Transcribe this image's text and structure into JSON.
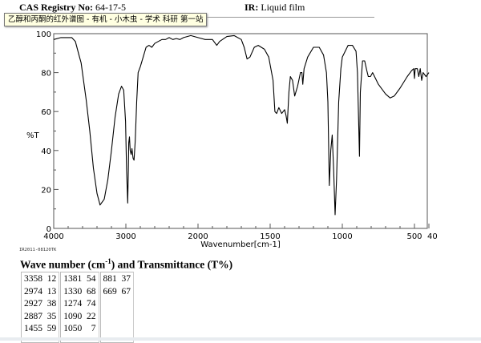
{
  "header": {
    "cas_label": "CAS Registry No:",
    "cas_value": "64-17-5",
    "ir_label": "IR:",
    "ir_value": "Liquid film"
  },
  "tooltip": "乙醇和丙酮的红外谱图 - 有机 - 小木虫 - 学术 科研 第一站",
  "spectrum_code": "IR2011-08120TK",
  "table": {
    "title_pre": "Wave number (cm",
    "title_sup": "-1",
    "title_post": ") and Transmittance (T%)",
    "columns": [
      [
        "3358  12",
        "2974  13",
        "2927  38",
        "2887  35",
        "1455  59"
      ],
      [
        "1381  54",
        "1330  68",
        "1274  74",
        "1090  22",
        "1050    7"
      ],
      [
        "881  37",
        "669  67"
      ]
    ]
  },
  "chart_data": {
    "type": "line",
    "xlabel": "Wavenumber[cm-1]",
    "ylabel": "%T",
    "xlim": [
      4000,
      400
    ],
    "ylim": [
      0,
      100
    ],
    "x_scale": "piecewise linear: 4000-2000 at half the density of 2000-400",
    "x_ticks": [
      4000,
      3000,
      2000,
      1500,
      1000,
      500,
      400
    ],
    "x_tick_labels": [
      "4000",
      "3000",
      "2000",
      "1500",
      "1000",
      "500",
      "40"
    ],
    "y_ticks": [
      0,
      20,
      40,
      60,
      80,
      100
    ],
    "grid": false,
    "line_color": "#000000",
    "peaks": [
      [
        3358,
        12
      ],
      [
        2974,
        13
      ],
      [
        2927,
        38
      ],
      [
        2887,
        35
      ],
      [
        1455,
        59
      ],
      [
        1381,
        54
      ],
      [
        1330,
        68
      ],
      [
        1274,
        74
      ],
      [
        1090,
        22
      ],
      [
        1050,
        7
      ],
      [
        881,
        37
      ],
      [
        669,
        67
      ]
    ],
    "series": [
      {
        "points": [
          [
            4000,
            97
          ],
          [
            3900,
            98
          ],
          [
            3750,
            98
          ],
          [
            3700,
            96
          ],
          [
            3650,
            89
          ],
          [
            3620,
            85
          ],
          [
            3550,
            66
          ],
          [
            3500,
            50
          ],
          [
            3450,
            31
          ],
          [
            3400,
            18
          ],
          [
            3358,
            12
          ],
          [
            3300,
            15
          ],
          [
            3250,
            25
          ],
          [
            3200,
            40
          ],
          [
            3150,
            57
          ],
          [
            3100,
            69
          ],
          [
            3060,
            73
          ],
          [
            3030,
            71
          ],
          [
            3005,
            55
          ],
          [
            2990,
            30
          ],
          [
            2974,
            13
          ],
          [
            2966,
            30
          ],
          [
            2960,
            44
          ],
          [
            2950,
            47
          ],
          [
            2940,
            40
          ],
          [
            2927,
            38
          ],
          [
            2915,
            41
          ],
          [
            2900,
            36
          ],
          [
            2887,
            35
          ],
          [
            2870,
            45
          ],
          [
            2850,
            65
          ],
          [
            2830,
            80
          ],
          [
            2800,
            83
          ],
          [
            2760,
            88
          ],
          [
            2720,
            93
          ],
          [
            2680,
            94
          ],
          [
            2640,
            93
          ],
          [
            2600,
            95
          ],
          [
            2550,
            96
          ],
          [
            2500,
            97
          ],
          [
            2450,
            97
          ],
          [
            2400,
            98
          ],
          [
            2350,
            97
          ],
          [
            2300,
            97.5
          ],
          [
            2250,
            97
          ],
          [
            2200,
            98
          ],
          [
            2100,
            99
          ],
          [
            2050,
            98.5
          ],
          [
            2000,
            98
          ],
          [
            1950,
            97
          ],
          [
            1900,
            97
          ],
          [
            1870,
            94
          ],
          [
            1850,
            96
          ],
          [
            1800,
            98.5
          ],
          [
            1750,
            99
          ],
          [
            1700,
            97
          ],
          [
            1680,
            93
          ],
          [
            1660,
            87
          ],
          [
            1640,
            88
          ],
          [
            1610,
            93
          ],
          [
            1583,
            94
          ],
          [
            1540,
            92
          ],
          [
            1510,
            88
          ],
          [
            1490,
            80
          ],
          [
            1480,
            76
          ],
          [
            1467,
            60
          ],
          [
            1455,
            59
          ],
          [
            1440,
            62
          ],
          [
            1420,
            59
          ],
          [
            1400,
            61
          ],
          [
            1390,
            58
          ],
          [
            1381,
            54
          ],
          [
            1370,
            70
          ],
          [
            1360,
            78
          ],
          [
            1345,
            76
          ],
          [
            1330,
            68
          ],
          [
            1310,
            73
          ],
          [
            1290,
            80
          ],
          [
            1280,
            80
          ],
          [
            1274,
            74
          ],
          [
            1265,
            82
          ],
          [
            1240,
            88
          ],
          [
            1200,
            93
          ],
          [
            1160,
            93
          ],
          [
            1130,
            89
          ],
          [
            1110,
            80
          ],
          [
            1100,
            65
          ],
          [
            1090,
            22
          ],
          [
            1080,
            40
          ],
          [
            1070,
            48
          ],
          [
            1060,
            30
          ],
          [
            1050,
            7
          ],
          [
            1040,
            25
          ],
          [
            1025,
            65
          ],
          [
            1010,
            82
          ],
          [
            1000,
            88
          ],
          [
            960,
            94
          ],
          [
            930,
            94
          ],
          [
            905,
            91
          ],
          [
            895,
            80
          ],
          [
            881,
            37
          ],
          [
            875,
            70
          ],
          [
            860,
            86
          ],
          [
            845,
            86
          ],
          [
            830,
            81
          ],
          [
            820,
            78
          ],
          [
            805,
            78
          ],
          [
            790,
            80
          ],
          [
            750,
            74
          ],
          [
            700,
            69
          ],
          [
            669,
            67
          ],
          [
            640,
            68
          ],
          [
            600,
            72
          ],
          [
            550,
            78
          ],
          [
            520,
            81
          ],
          [
            505,
            82
          ],
          [
            500,
            77
          ],
          [
            495,
            82
          ],
          [
            480,
            82
          ],
          [
            470,
            78
          ],
          [
            460,
            82
          ],
          [
            450,
            76
          ],
          [
            440,
            80
          ],
          [
            420,
            78
          ],
          [
            400,
            80
          ]
        ]
      }
    ]
  }
}
